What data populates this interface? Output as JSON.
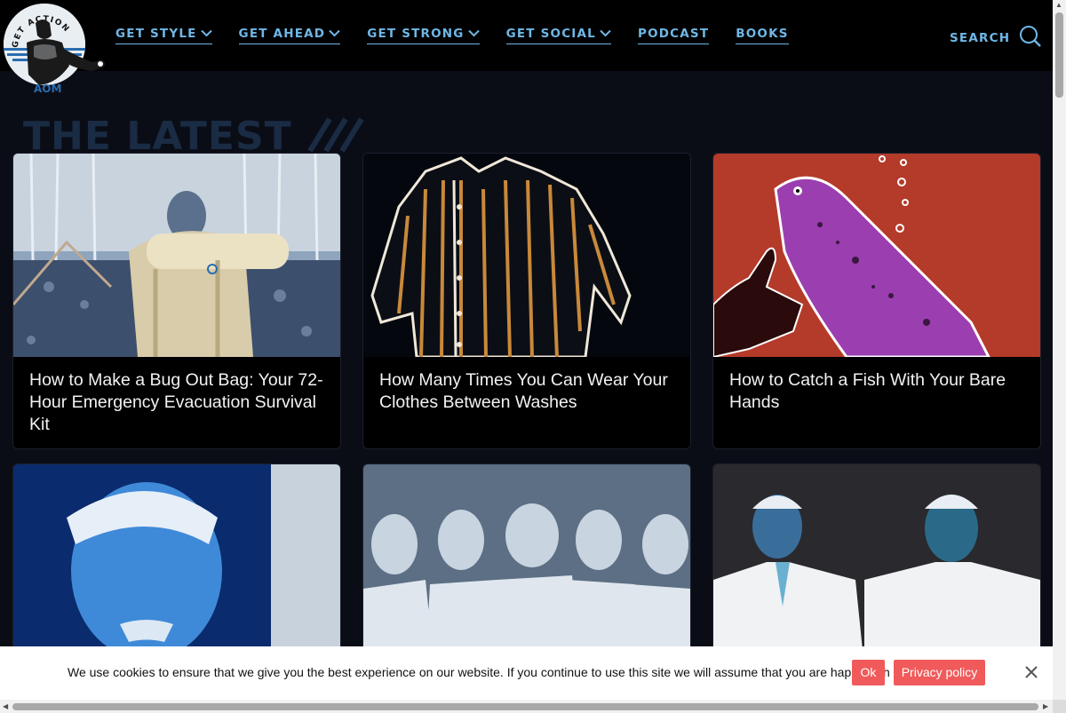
{
  "nav": {
    "items": [
      {
        "label": "GET STYLE",
        "has_dropdown": true
      },
      {
        "label": "GET AHEAD",
        "has_dropdown": true
      },
      {
        "label": "GET STRONG",
        "has_dropdown": true
      },
      {
        "label": "GET SOCIAL",
        "has_dropdown": true
      },
      {
        "label": "PODCAST",
        "has_dropdown": false
      },
      {
        "label": "BOOKS",
        "has_dropdown": false
      }
    ],
    "search_label": "SEARCH"
  },
  "logo": {
    "top_text": "GET ACTION",
    "bottom_text": "AOM"
  },
  "section_title": "THE LATEST",
  "articles": [
    {
      "title": "How to Make a Bug Out Bag: Your 72-Hour Emergency Evacuation Survival Kit"
    },
    {
      "title": "How Many Times You Can Wear Your Clothes Between Washes"
    },
    {
      "title": "How to Catch a Fish With Your Bare Hands"
    },
    {
      "title": ""
    },
    {
      "title": ""
    },
    {
      "title": ""
    }
  ],
  "cookie": {
    "message": "We use cookies to ensure that we give you the best experience on our website. If you continue to use this site we will assume that you are happy with it.",
    "ok_label": "Ok",
    "privacy_label": "Privacy policy"
  },
  "colors": {
    "accent": "#6fb7e6",
    "background": "#0b0d16",
    "cookie_button": "#f05a5a"
  }
}
